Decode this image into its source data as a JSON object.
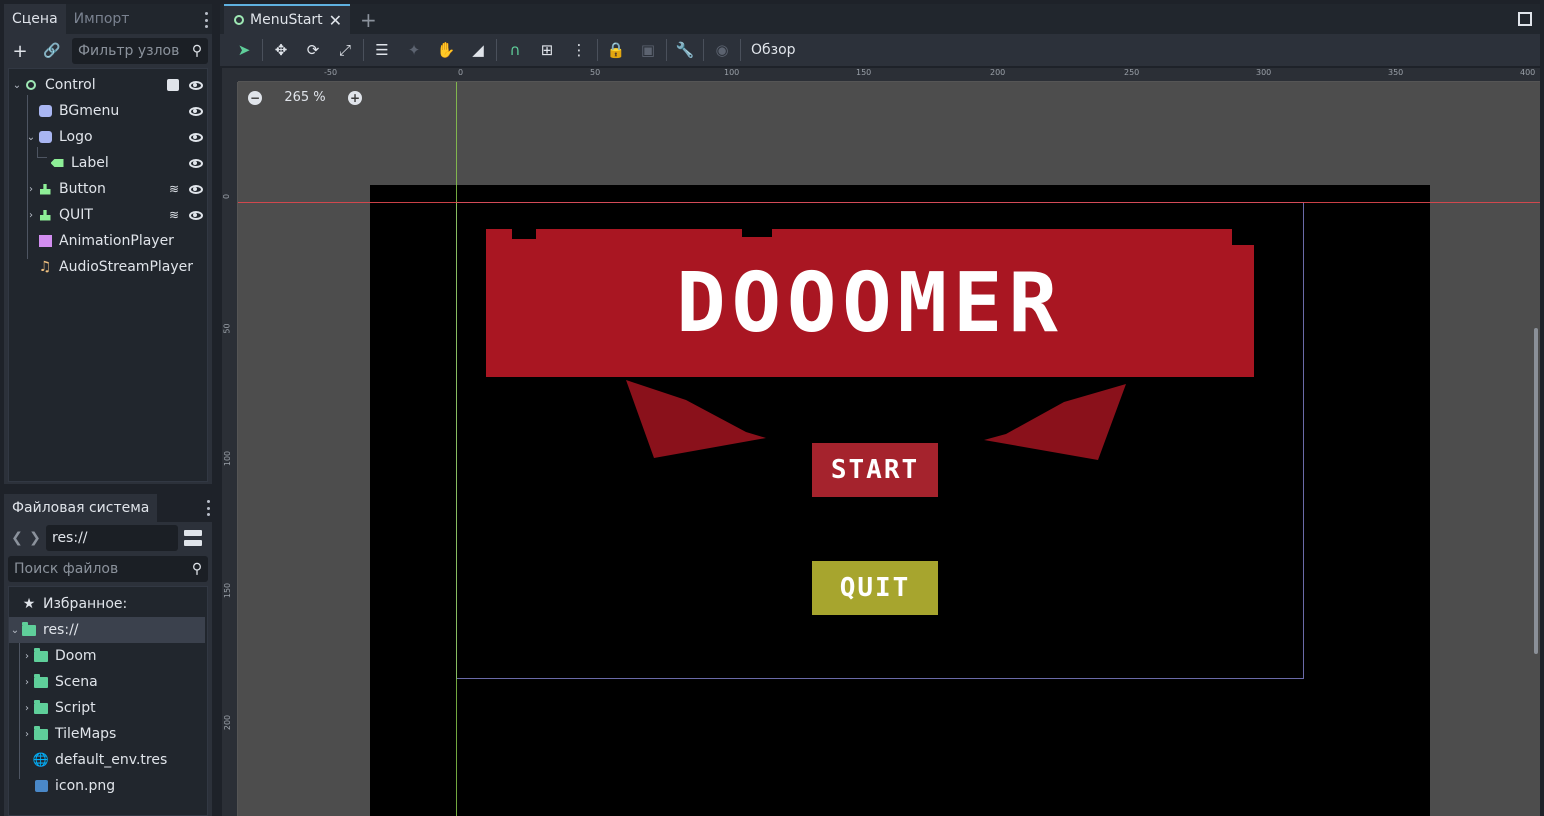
{
  "scene_panel": {
    "tabs": [
      "Сцена",
      "Импорт"
    ],
    "filter_placeholder": "Фильтр узлов",
    "nodes": [
      {
        "name": "Control",
        "icon": "control-ring-icon"
      },
      {
        "name": "BGmenu",
        "icon": "texture-rect-icon"
      },
      {
        "name": "Logo",
        "icon": "texture-rect-icon"
      },
      {
        "name": "Label",
        "icon": "label-icon"
      },
      {
        "name": "Button",
        "icon": "button-icon"
      },
      {
        "name": "QUIT",
        "icon": "button-icon"
      },
      {
        "name": "AnimationPlayer",
        "icon": "animation-player-icon"
      },
      {
        "name": "AudioStreamPlayer",
        "icon": "audio-stream-icon"
      }
    ]
  },
  "fs_panel": {
    "tab": "Файловая система",
    "path": "res://",
    "search_placeholder": "Поиск файлов",
    "favorites": "Избранное:",
    "root": "res://",
    "items": [
      "Doom",
      "Scena",
      "Script",
      "TileMaps",
      "default_env.tres",
      "icon.png"
    ]
  },
  "editor": {
    "tab_title": "MenuStart",
    "toolbar_label": "Обзор",
    "zoom": "265 %",
    "ruler_top": [
      "-50",
      "0",
      "50",
      "100",
      "150",
      "200",
      "250",
      "300",
      "350",
      "400"
    ],
    "ruler_left": [
      "0",
      "50",
      "100",
      "150",
      "200"
    ]
  },
  "game": {
    "title": "DOOOMER",
    "start": "START",
    "quit": "QUIT"
  },
  "colors": {
    "banner": "#a91622",
    "start": "#a5232d",
    "quit": "#a7a52e",
    "accent": "#5fcf9a"
  }
}
